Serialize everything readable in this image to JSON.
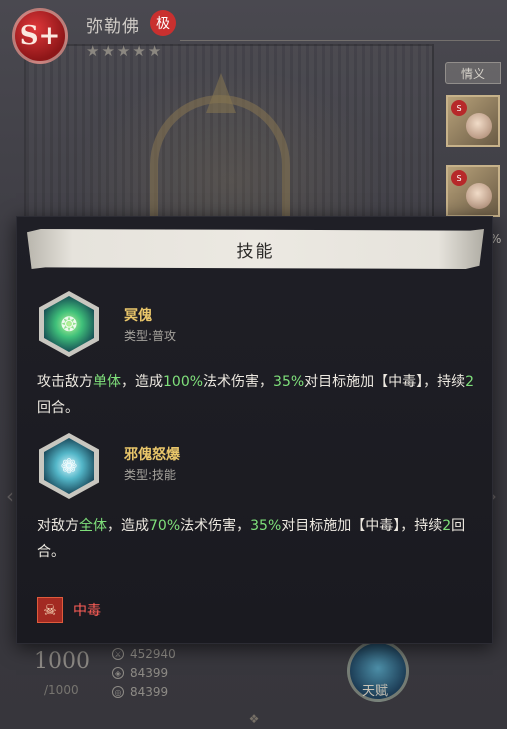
{
  "hero": {
    "rank": "S+",
    "name": "弥勒佛",
    "rarity_tag": "极",
    "stars": 5
  },
  "side_panel": {
    "affinity_button": "情义",
    "percent_fragment": "%"
  },
  "dialog": {
    "title": "技能",
    "skills": [
      {
        "name": "冥傀",
        "type": "类型:普攻",
        "desc_parts": [
          {
            "text": "攻击敌方",
            "hl": false
          },
          {
            "text": "单体",
            "hl": true
          },
          {
            "text": "，造成",
            "hl": false
          },
          {
            "text": "100%",
            "hl": true
          },
          {
            "text": "法术伤害，",
            "hl": false
          },
          {
            "text": "35%",
            "hl": true
          },
          {
            "text": "对目标施加【中毒】，持续",
            "hl": false
          },
          {
            "text": "2",
            "hl": true
          },
          {
            "text": "回合。",
            "hl": false
          }
        ]
      },
      {
        "name": "邪傀怒爆",
        "type": "类型:技能",
        "desc_parts": [
          {
            "text": "对敌方",
            "hl": false
          },
          {
            "text": "全体",
            "hl": true
          },
          {
            "text": "，造成",
            "hl": false
          },
          {
            "text": "70%",
            "hl": true
          },
          {
            "text": "法术伤害，",
            "hl": false
          },
          {
            "text": "35%",
            "hl": true
          },
          {
            "text": "对目标施加【中毒】，持续",
            "hl": false
          },
          {
            "text": "2",
            "hl": true
          },
          {
            "text": "回合。",
            "hl": false
          }
        ]
      }
    ],
    "status_effect": {
      "icon": "skull-icon",
      "label": "中毒"
    }
  },
  "stats": {
    "level": "1000",
    "level_max": "/1000",
    "rows": [
      {
        "icon": "sword-icon",
        "value": "452940"
      },
      {
        "icon": "shield-icon",
        "value": "84399"
      },
      {
        "icon": "orb-icon",
        "value": "84399"
      }
    ],
    "talent_label": "天赋"
  },
  "colors": {
    "highlight": "#7fe07b",
    "skill_name": "#e9c66a",
    "effect": "#ff5e57",
    "rank_badge": "#c9302f"
  }
}
